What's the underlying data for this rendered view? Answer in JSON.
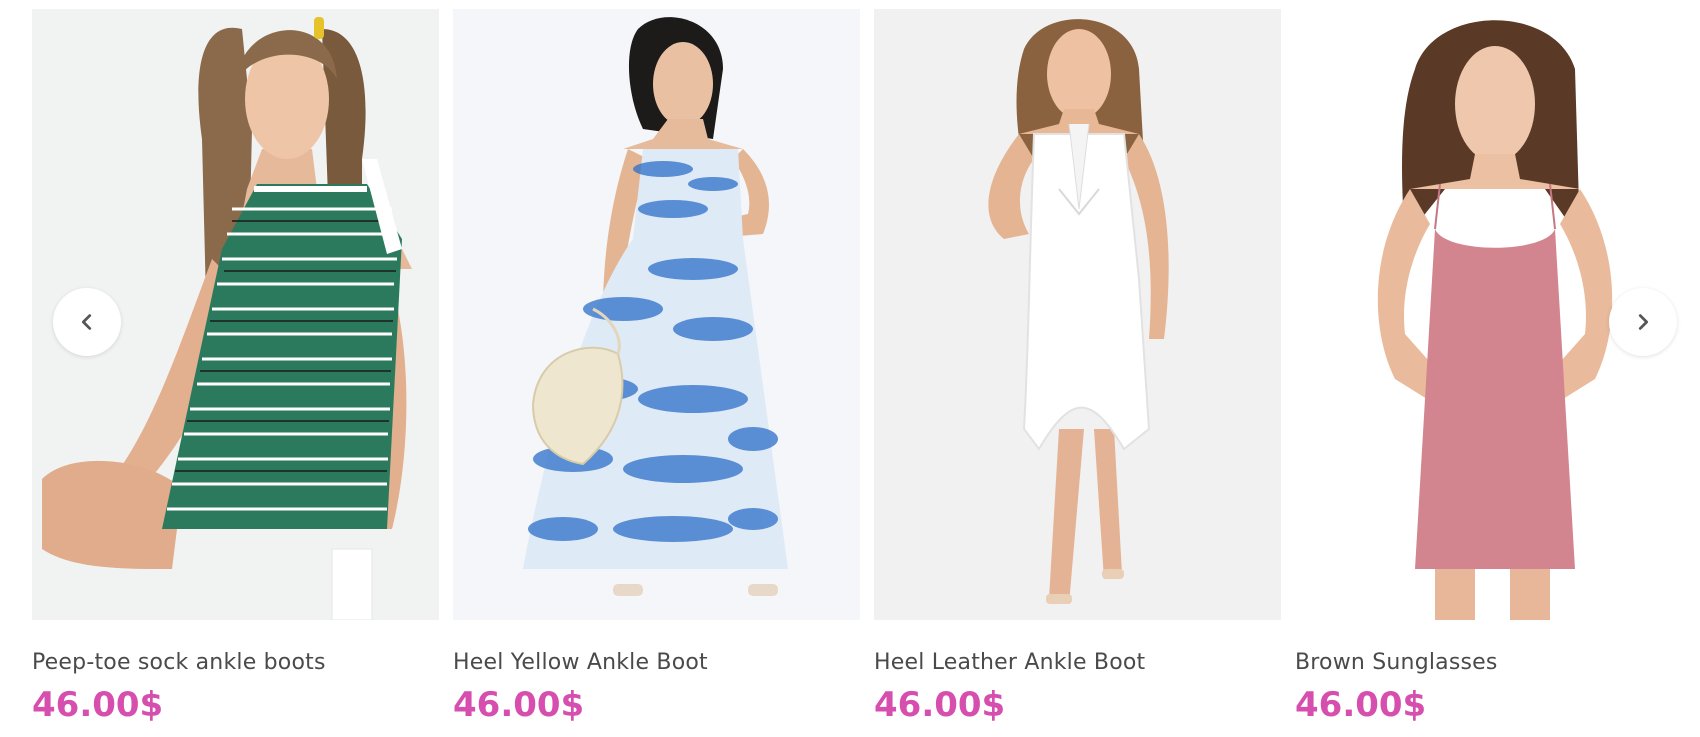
{
  "colors": {
    "price": "#d64fae",
    "title": "#4a4a4a",
    "nav_bg": "#ffffff",
    "nav_arrow": "#555555"
  },
  "nav": {
    "prev_icon": "chevron-left-icon",
    "next_icon": "chevron-right-icon"
  },
  "products": [
    {
      "title": "Peep-toe sock ankle boots",
      "price": "46.00$",
      "image": "model in green striped tank dress"
    },
    {
      "title": "Heel Yellow Ankle Boot",
      "price": "46.00$",
      "image": "model in blue tie-dye maxi dress"
    },
    {
      "title": "Heel Leather Ankle Boot",
      "price": "46.00$",
      "image": "model in white wrap dress"
    },
    {
      "title": "Brown Sunglasses",
      "price": "46.00$",
      "image": "model in pink slip dress"
    }
  ]
}
